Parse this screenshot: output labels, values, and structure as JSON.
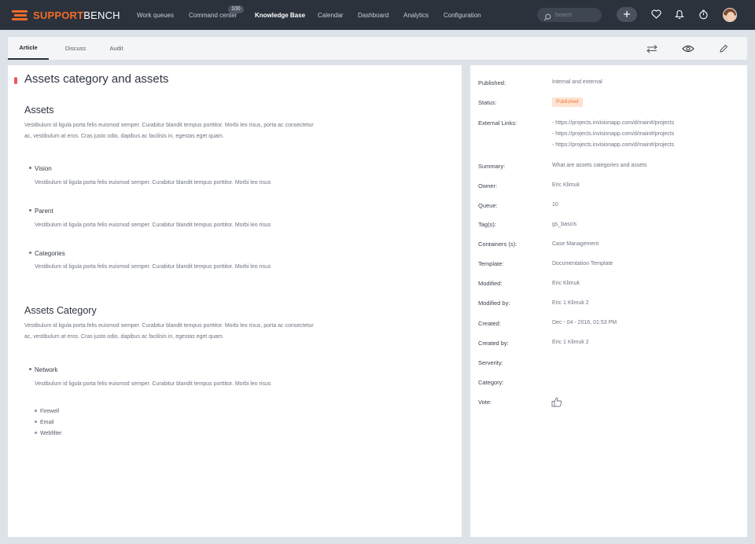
{
  "app": {
    "logo_part1": "SUPPORT",
    "logo_part2": "BENCH",
    "brand_color": "#f26b2a"
  },
  "nav": {
    "items": [
      "Work queues",
      "Command center",
      "Knowledge Base",
      "Calendar",
      "Dashboard",
      "Analytics",
      "Configuration"
    ],
    "active": "Knowledge Base",
    "badge": "100",
    "search_placeholder": "Search"
  },
  "tabs": [
    "Article",
    "Discuss",
    "Audit"
  ],
  "active_tab": "Article",
  "article": {
    "title": "Assets category and assets",
    "indicator_color": "#f0565e",
    "sections": [
      {
        "heading": "Assets",
        "body": "Vestibulum id ligula porta felis euismod semper. Curabitur blandit tempus porttitor. Morbi leo risus, porta ac consectetur ac, vestibulum at eros. Cras justo odio, dapibus ac facilisis in, egestas eget quam.",
        "items": [
          {
            "title": "Vision",
            "text": "Vestibulum id ligula porta felis euismod semper. Curabitur blandit tempus porttitor. Morbi leo risus"
          },
          {
            "title": "Parent",
            "text": "Vestibulum id ligula porta felis euismod semper. Curabitur blandit tempus porttitor. Morbi leo risus"
          },
          {
            "title": "Categories",
            "text": "Vestibulum id ligula porta felis euismod semper. Curabitur blandit tempus porttitor. Morbi leo risus"
          }
        ]
      },
      {
        "heading": "Assets Category",
        "body": "Vestibulum id ligula porta felis euismod semper. Curabitur blandit tempus porttitor. Morbi leo risus, porta ac consectetur ac, vestibulum at eros. Cras justo odio, dapibus ac facilisis in, egestas eget quam.",
        "items": [
          {
            "title": "Network",
            "text": "Vestibulum id ligula porta felis euismod semper. Curabitur blandit tempus porttitor. Morbi leo risus"
          }
        ],
        "sub_items": [
          "Firewell",
          "Email",
          "Webfilter"
        ]
      }
    ]
  },
  "properties": {
    "published_label": "Published:",
    "published_value": "Internal and external",
    "status_label": "Status:",
    "status_value": "Published",
    "links_label": "External Links:",
    "links": [
      "- https://projects.invisionapp.com/d/main#/projects",
      "- https://projects.invisionapp.com/d/main#/projects",
      "- https://projects.invisionapp.com/d/main#/projects"
    ],
    "summary_label": "Summary:",
    "summary_value": "What are assets categories and assets",
    "owner_label": "Owner:",
    "owner_value": "Eric Klimuk",
    "queue_label": "Queue:",
    "queue_value": "10",
    "tags_label": "Tag(s):",
    "tags_value": "gs_bascis",
    "containers_label": "Containers (s):",
    "containers_value": "Case Management",
    "template_label": "Template:",
    "template_value": "Documentation Template",
    "modified_label": "Modified:",
    "modified_value": "Eric Klimuk",
    "modified_by_label": "Modified by:",
    "modified_by_value": "Eric 1 Klimuk 2",
    "created_label": "Created:",
    "created_value": "Dec - 04 - 2016, 01:53 PM",
    "created_by_label": "Created by:",
    "created_by_value": "Eric 1 Klimuk 2",
    "severity_label": "Serverity:",
    "severity_value": "",
    "category_label": "Category:",
    "category_value": "",
    "vote_label": "Vote:"
  },
  "icons": {
    "search": "search-icon",
    "add": "plus-icon",
    "favorite": "heart-icon",
    "notifications": "bell-icon",
    "timer": "stopwatch-icon",
    "swap": "swap-arrows-icon",
    "watch": "eye-icon",
    "edit": "pencil-icon",
    "vote": "thumbs-up-icon"
  }
}
